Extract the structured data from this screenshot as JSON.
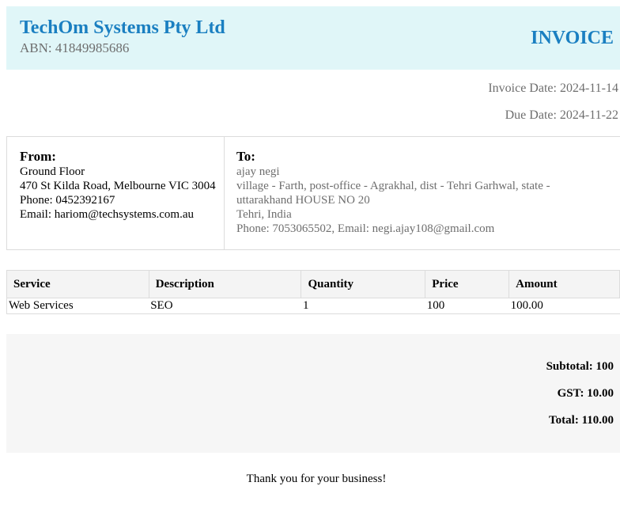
{
  "header": {
    "company_name": "TechOm Systems Pty Ltd",
    "abn": "ABN: 41849985686",
    "title": "INVOICE"
  },
  "meta": {
    "invoice_date": "Invoice Date: 2024-11-14",
    "due_date": "Due Date: 2024-11-22"
  },
  "from": {
    "heading": "From:",
    "line1": "Ground Floor",
    "line2": "470 St Kilda Road, Melbourne VIC 3004",
    "phone": "Phone: 0452392167",
    "email": "Email: hariom@techsystems.com.au"
  },
  "to": {
    "heading": "To:",
    "name": "ajay negi",
    "address": "village - Farth, post-office - Agrakhal, dist - Tehri Garhwal, state - uttarakhand HOUSE NO 20",
    "city": "Tehri, India",
    "contact": "Phone: 7053065502, Email: negi.ajay108@gmail.com"
  },
  "table": {
    "headers": [
      "Service",
      "Description",
      "Quantity",
      "Price",
      "Amount"
    ],
    "rows": [
      [
        "Web Services",
        "SEO",
        "1",
        "100",
        "100.00"
      ]
    ]
  },
  "totals": {
    "subtotal": "Subtotal: 100",
    "gst": "GST: 10.00",
    "total": "Total: 110.00"
  },
  "footer": {
    "thanks": "Thank you for your business!"
  }
}
